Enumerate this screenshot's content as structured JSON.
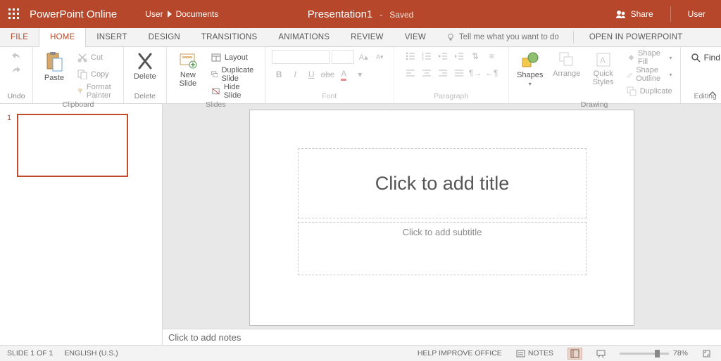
{
  "titlebar": {
    "app_name": "PowerPoint Online",
    "user_crumb": "User",
    "folder_crumb": "Documents",
    "doc_title": "Presentation1",
    "save_dash": "-",
    "save_status": "Saved",
    "share": "Share",
    "user": "User"
  },
  "tabs": {
    "file": "FILE",
    "home": "HOME",
    "insert": "INSERT",
    "design": "DESIGN",
    "transitions": "TRANSITIONS",
    "animations": "ANIMATIONS",
    "review": "REVIEW",
    "view": "VIEW",
    "tellme": "Tell me what you want to do",
    "open_in": "OPEN IN POWERPOINT"
  },
  "ribbon": {
    "undo_group": "Undo",
    "clipboard_group": "Clipboard",
    "paste": "Paste",
    "cut": "Cut",
    "copy": "Copy",
    "format_painter": "Format Painter",
    "delete_group": "Delete",
    "delete": "Delete",
    "slides_group": "Slides",
    "new_slide": "New\nSlide",
    "layout": "Layout",
    "duplicate_slide": "Duplicate Slide",
    "hide_slide": "Hide Slide",
    "font_group": "Font",
    "paragraph_group": "Paragraph",
    "drawing_group": "Drawing",
    "shapes": "Shapes",
    "arrange": "Arrange",
    "quick_styles": "Quick\nStyles",
    "shape_fill": "Shape Fill",
    "shape_outline": "Shape Outline",
    "duplicate": "Duplicate",
    "editing_group": "Editing",
    "find": "Find"
  },
  "slide": {
    "number": "1",
    "title_placeholder": "Click to add title",
    "subtitle_placeholder": "Click to add subtitle",
    "notes_placeholder": "Click to add notes"
  },
  "status": {
    "slide_pos": "SLIDE 1 OF 1",
    "language": "ENGLISH (U.S.)",
    "help_improve": "HELP IMPROVE OFFICE",
    "notes": "NOTES",
    "zoom_pct": "78%"
  }
}
